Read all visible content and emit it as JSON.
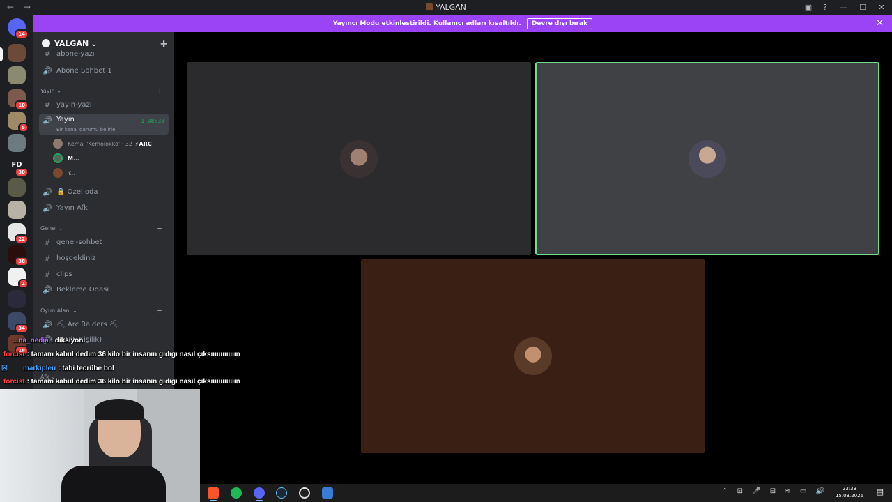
{
  "window": {
    "title": "YALGAN",
    "nav_back": "←",
    "nav_forward": "→",
    "controls": [
      "▣",
      "?",
      "—",
      "☐",
      "✕"
    ]
  },
  "banner": {
    "message": "Yayıncı Modu etkinleştirildi. Kullanıcı adları kısaltıldı.",
    "button": "Devre dışı bırak",
    "close": "✕",
    "color": "#9b44f5"
  },
  "server_rail": {
    "badges": [
      "14",
      "10",
      "5",
      "30",
      "22",
      "38",
      "1",
      "34",
      "18"
    ],
    "fd_label": "FD"
  },
  "guild": {
    "name": "YALGAN",
    "chevron": "⌄",
    "add_member_icon": "✚"
  },
  "channels": {
    "top_partial": "abone-yazı",
    "abone_sohbet": "Abone Sohbet 1",
    "cat_yayin": "Yayın",
    "yayin_yazi": "yayın-yazı",
    "active_voice": "Yayın",
    "active_timer": "1:08:33",
    "active_status": "Bir kanal durumu belirle",
    "voice_users": [
      {
        "name": "Kemal 'Kemolokko' · 32",
        "tag": "⚡ARC"
      },
      {
        "name": "M..."
      },
      {
        "name": "Y..."
      }
    ],
    "ozel_oda": "🔒 Özel oda",
    "yayin_afk": "Yayın Afk",
    "cat_genel": "Genel",
    "genel_sohbet": "genel-sohbet",
    "hosgeldiniz": "hoşgeldiniz",
    "clips": "clips",
    "bekleme": "Bekleme Odası",
    "cat_oyun": "Oyun Alanı",
    "arc_raiders": "⛏ Arc Raiders ⛏",
    "voice2": "...2 (5 Kişilik)",
    "cat_afk": "Afk"
  },
  "chat_overlay": [
    {
      "user": "...na_nedia",
      "text": ": diksiyon",
      "color": "#b36bff"
    },
    {
      "user": "forcist",
      "text": ": tamam kabul dedim 36 kilo bir insanın gıdıgı nasıl çıksııııııııııııın",
      "color": "#ff3b3b"
    },
    {
      "user": "markipleu",
      "text": ": tabi tecrübe bol",
      "color": "#4aa3ff"
    },
    {
      "user": "forcist",
      "text": ": tamam kabul dedim 36 kilo bir insanın gıdıgı nasıl çıksııııııııııııın",
      "color": "#ff3b3b"
    }
  ],
  "taskbar": {
    "time": "23:33",
    "date": "15.03.2026",
    "tray_icons": "⌃ ⊡ 🎤 ⊟ ≋ ▭ 🔊",
    "notif_icon": "▤"
  },
  "colors": {
    "accent": "#9b44f5",
    "speaking_border": "#6fdc8c",
    "online": "#23a55a",
    "badge": "#f23f43"
  }
}
